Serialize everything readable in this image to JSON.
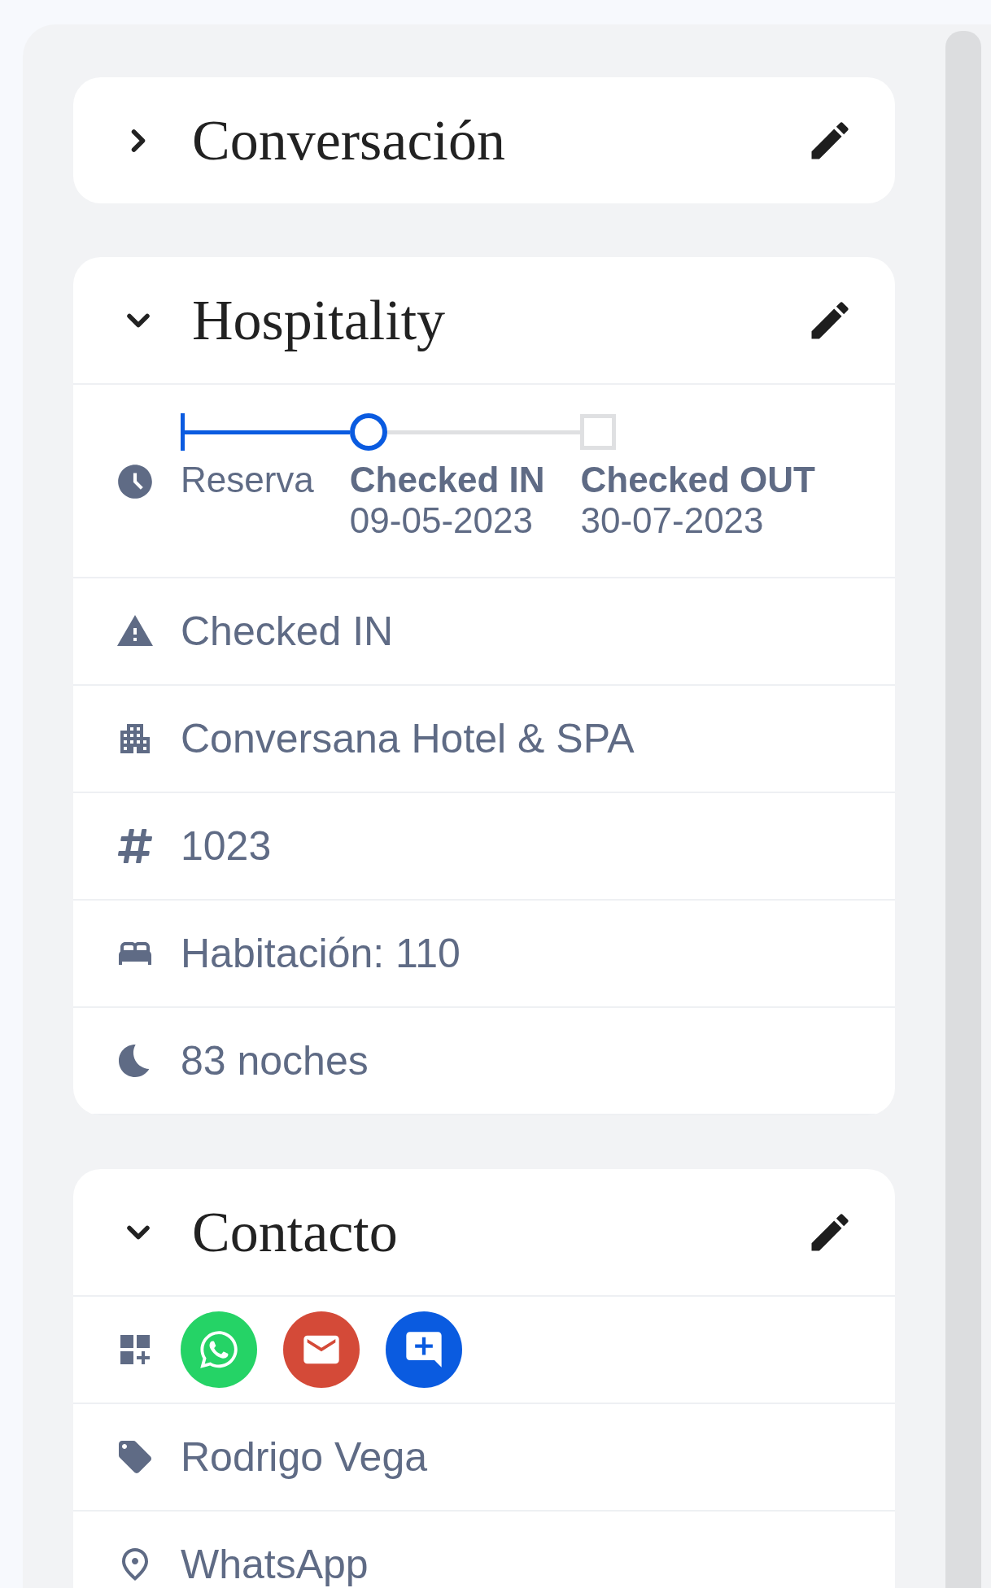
{
  "sections": [
    {
      "title": "Conversación",
      "expanded": false
    },
    {
      "title": "Hospitality",
      "expanded": true,
      "timeline": [
        {
          "label": "Reserva",
          "kind": "start"
        },
        {
          "label": "Checked IN",
          "date": "09-05-2023",
          "kind": "current"
        },
        {
          "label": "Checked OUT",
          "date": "30-07-2023",
          "kind": "pending"
        }
      ],
      "rows": [
        {
          "kind": "status",
          "text": "Checked IN"
        },
        {
          "kind": "hotel",
          "text": "Conversana Hotel & SPA"
        },
        {
          "kind": "number",
          "text": "1023"
        },
        {
          "kind": "room",
          "text": "Habitación: 110"
        },
        {
          "kind": "nights",
          "text": "83 noches"
        }
      ]
    },
    {
      "title": "Contacto",
      "expanded": true,
      "channels": [
        {
          "kind": "whatsapp",
          "color": "#25d366"
        },
        {
          "kind": "email",
          "color": "#d44a38"
        },
        {
          "kind": "chat",
          "color": "#0a5be0"
        }
      ],
      "rows": [
        {
          "kind": "name",
          "text": "Rodrigo Vega"
        },
        {
          "kind": "channel",
          "text": "WhatsApp"
        }
      ]
    }
  ]
}
